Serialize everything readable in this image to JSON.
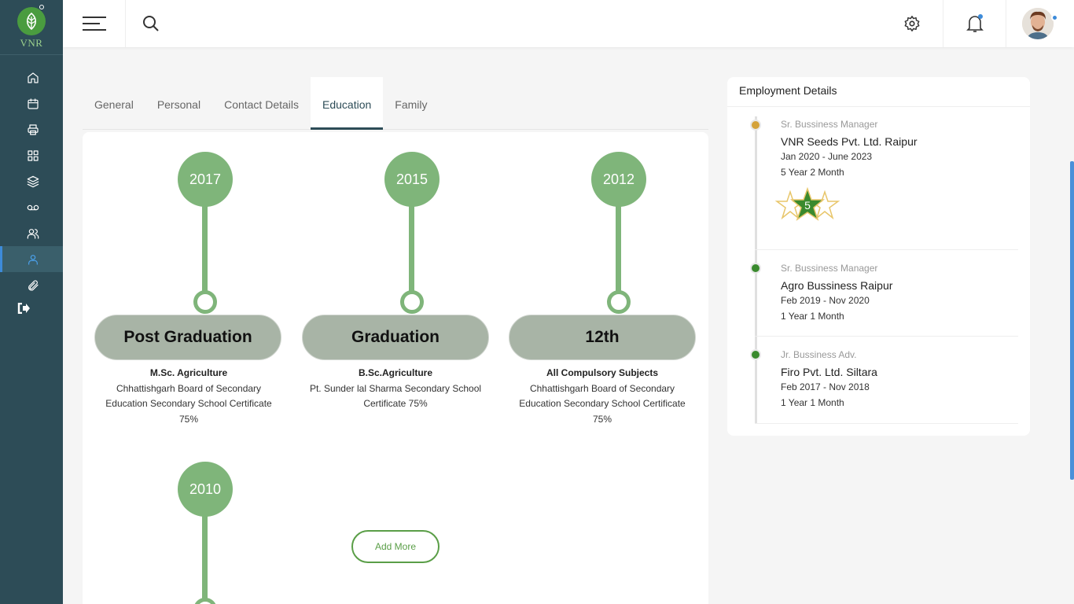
{
  "brand": {
    "logo_text": "VNR"
  },
  "tabs": [
    {
      "label": "General"
    },
    {
      "label": "Personal"
    },
    {
      "label": "Contact Details"
    },
    {
      "label": "Education"
    },
    {
      "label": "Family"
    }
  ],
  "active_tab": "Education",
  "education": [
    {
      "year": "2017",
      "level": "Post Graduation",
      "title": "M.Sc. Agriculture",
      "line1": "Chhattishgarh Board of Secondary",
      "line2": "Education Secondary School Certificate",
      "line3": "75%"
    },
    {
      "year": "2015",
      "level": "Graduation",
      "title": "B.Sc.Agriculture",
      "line1": "Pt. Sunder lal Sharma Secondary School",
      "line2": "Certificate 75%",
      "line3": ""
    },
    {
      "year": "2012",
      "level": "12th",
      "title": "All Compulsory Subjects",
      "line1": "Chhattishgarh Board of Secondary",
      "line2": "Education Secondary School Certificate",
      "line3": "75%"
    },
    {
      "year": "2010"
    }
  ],
  "add_more_label": "Add More",
  "employment": {
    "header": "Employment Details",
    "items": [
      {
        "role": "Sr. Bussiness Manager",
        "company": "VNR Seeds Pvt. Ltd. Raipur",
        "dates": "Jan 2020 - June 2023",
        "duration": "5 Year 2 Month",
        "rating": "5",
        "dot_color": "#d4a23a"
      },
      {
        "role": "Sr. Bussiness Manager",
        "company": "Agro Bussiness Raipur",
        "dates": "Feb 2019 - Nov 2020",
        "duration": "1 Year 1 Month",
        "dot_color": "#3a8a2e"
      },
      {
        "role": "Jr. Bussiness Adv.",
        "company": "Firo Pvt. Ltd. Siltara",
        "dates": "Feb 2017 - Nov 2018",
        "duration": "1 Year 1 Month",
        "dot_color": "#3a8a2e"
      }
    ]
  },
  "icons": {
    "sidebar": [
      "home-icon",
      "calendar-icon",
      "printer-icon",
      "grid-icon",
      "layers-icon",
      "voicemail-icon",
      "users-icon",
      "user-icon",
      "paperclip-icon",
      "logout-icon"
    ],
    "topbar": [
      "menu-icon",
      "search-icon",
      "gear-icon",
      "bell-icon"
    ]
  },
  "colors": {
    "sidebar": "#2d4c57",
    "accent_green": "#7fb57a",
    "active_blue": "#3d8bd9",
    "button_green": "#5a9e47"
  }
}
